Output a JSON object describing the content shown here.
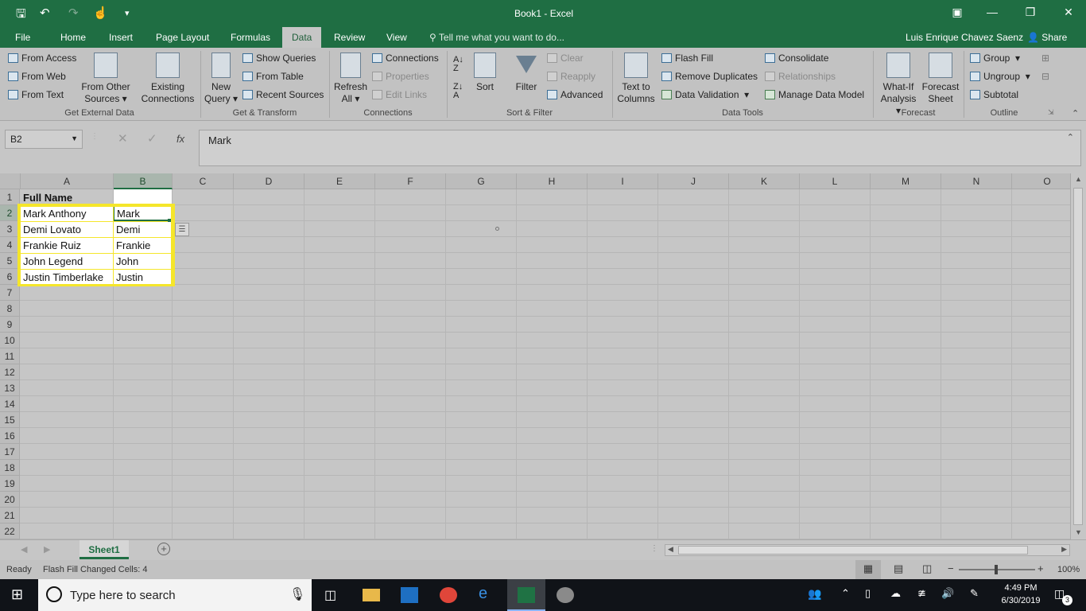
{
  "window": {
    "title": "Book1 - Excel",
    "user": "Luis Enrique Chavez Saenz",
    "share": "Share"
  },
  "tabs": [
    "File",
    "Home",
    "Insert",
    "Page Layout",
    "Formulas",
    "Data",
    "Review",
    "View"
  ],
  "tell_me": "Tell me what you want to do...",
  "ribbon": {
    "get_external": {
      "from_access": "From Access",
      "from_web": "From Web",
      "from_text": "From Text",
      "from_other_1": "From Other",
      "from_other_2": "Sources",
      "existing_1": "Existing",
      "existing_2": "Connections",
      "label": "Get External Data"
    },
    "get_transform": {
      "new_query_1": "New",
      "new_query_2": "Query",
      "show_queries": "Show Queries",
      "from_table": "From Table",
      "recent_sources": "Recent Sources",
      "label": "Get & Transform"
    },
    "connections": {
      "refresh_1": "Refresh",
      "refresh_2": "All",
      "connections": "Connections",
      "properties": "Properties",
      "edit_links": "Edit Links",
      "label": "Connections"
    },
    "sort_filter": {
      "sort": "Sort",
      "filter": "Filter",
      "clear": "Clear",
      "reapply": "Reapply",
      "advanced": "Advanced",
      "label": "Sort & Filter"
    },
    "data_tools": {
      "text_cols_1": "Text to",
      "text_cols_2": "Columns",
      "flash_fill": "Flash Fill",
      "remove_dup": "Remove Duplicates",
      "data_val": "Data Validation",
      "consolidate": "Consolidate",
      "relationships": "Relationships",
      "manage_model": "Manage Data Model",
      "label": "Data Tools"
    },
    "forecast": {
      "whatif_1": "What-If",
      "whatif_2": "Analysis",
      "forecast_1": "Forecast",
      "forecast_2": "Sheet",
      "label": "Forecast"
    },
    "outline": {
      "group": "Group",
      "ungroup": "Ungroup",
      "subtotal": "Subtotal",
      "label": "Outline"
    }
  },
  "formula_bar": {
    "name_box": "B2",
    "fx": "fx",
    "value": "Mark"
  },
  "columns": [
    "A",
    "B",
    "C",
    "D",
    "E",
    "F",
    "G",
    "H",
    "I",
    "J",
    "K",
    "L",
    "M",
    "N",
    "O"
  ],
  "rows": [
    "1",
    "2",
    "3",
    "4",
    "5",
    "6",
    "7",
    "8",
    "9",
    "10",
    "11",
    "12",
    "13",
    "14",
    "15",
    "16",
    "17",
    "18",
    "19",
    "20",
    "21",
    "22"
  ],
  "cells": {
    "A1": "Full Name",
    "A2": "Mark Anthony",
    "B2": "Mark",
    "A3": "Demi Lovato",
    "B3": "Demi",
    "A4": "Frankie Ruiz",
    "B4": "Frankie",
    "A5": "John Legend",
    "B5": "John",
    "A6": "Justin Timberlake",
    "B6": "Justin"
  },
  "sheet_tab": "Sheet1",
  "status": {
    "ready": "Ready",
    "message": "Flash Fill Changed Cells: 4",
    "zoom": "100%"
  },
  "taskbar": {
    "search_placeholder": "Type here to search",
    "time": "4:49 PM",
    "date": "6/30/2019",
    "notifications": "3"
  },
  "colors": {
    "excel_green": "#1f6e43",
    "highlight_yellow": "#f5e62a",
    "taskbar": "#101318"
  }
}
